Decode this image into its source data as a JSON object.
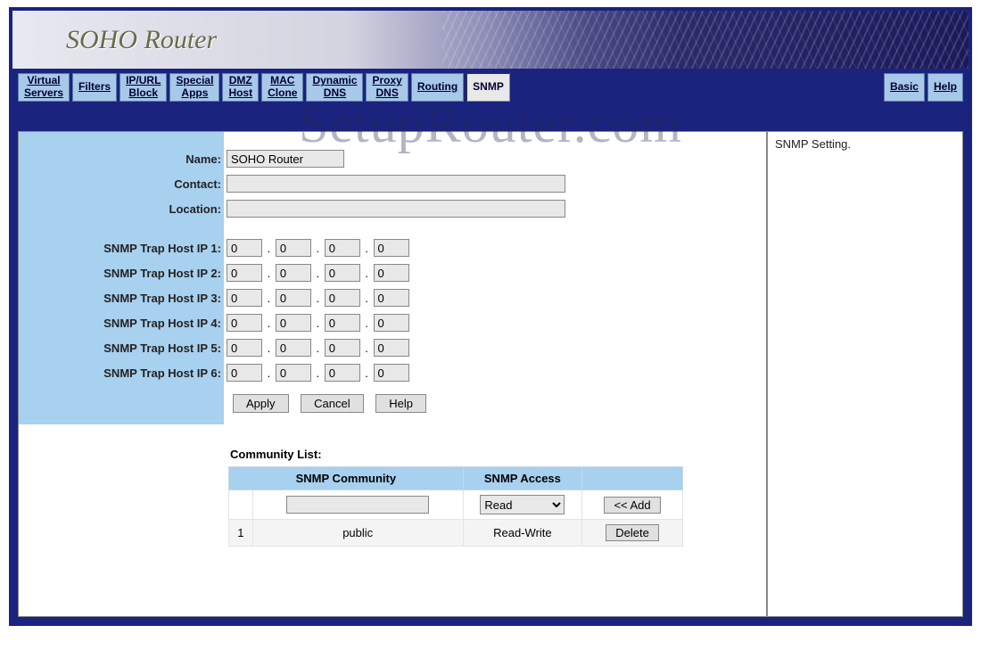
{
  "banner": {
    "title": "SOHO Router"
  },
  "watermark": "SetupRouter.com",
  "nav": {
    "items": [
      {
        "id": "virtual-servers",
        "line1": "Virtual",
        "line2": "Servers",
        "active": false
      },
      {
        "id": "filters",
        "line1": "Filters",
        "line2": "",
        "active": false
      },
      {
        "id": "ip-url-block",
        "line1": "IP/URL",
        "line2": "Block",
        "active": false
      },
      {
        "id": "special-apps",
        "line1": "Special",
        "line2": "Apps",
        "active": false
      },
      {
        "id": "dmz-host",
        "line1": "DMZ",
        "line2": "Host",
        "active": false
      },
      {
        "id": "mac-clone",
        "line1": "MAC",
        "line2": "Clone",
        "active": false
      },
      {
        "id": "dynamic-dns",
        "line1": "Dynamic",
        "line2": "DNS",
        "active": false
      },
      {
        "id": "proxy-dns",
        "line1": "Proxy",
        "line2": "DNS",
        "active": false
      },
      {
        "id": "routing",
        "line1": "Routing",
        "line2": "",
        "active": false
      },
      {
        "id": "snmp",
        "line1": "SNMP",
        "line2": "",
        "active": true
      }
    ],
    "right": [
      {
        "id": "basic",
        "label": "Basic"
      },
      {
        "id": "help",
        "label": "Help"
      }
    ]
  },
  "help": {
    "text": "SNMP Setting."
  },
  "form": {
    "labels": {
      "name": "Name:",
      "contact": "Contact:",
      "location": "Location:",
      "trap_prefix": "SNMP Trap Host IP"
    },
    "values": {
      "name": "SOHO Router",
      "contact": "",
      "location": "",
      "traps": [
        [
          "0",
          "0",
          "0",
          "0"
        ],
        [
          "0",
          "0",
          "0",
          "0"
        ],
        [
          "0",
          "0",
          "0",
          "0"
        ],
        [
          "0",
          "0",
          "0",
          "0"
        ],
        [
          "0",
          "0",
          "0",
          "0"
        ],
        [
          "0",
          "0",
          "0",
          "0"
        ]
      ]
    },
    "buttons": {
      "apply": "Apply",
      "cancel": "Cancel",
      "help": "Help"
    }
  },
  "community": {
    "title": "Community List:",
    "headers": {
      "col1": "SNMP Community",
      "col2": "SNMP Access",
      "col3": ""
    },
    "input_row": {
      "community_value": "",
      "access_selected": "Read",
      "access_options": [
        "Read",
        "Read-Write"
      ],
      "add_button": "<< Add"
    },
    "rows": [
      {
        "idx": "1",
        "community": "public",
        "access": "Read-Write",
        "action": "Delete"
      }
    ]
  }
}
